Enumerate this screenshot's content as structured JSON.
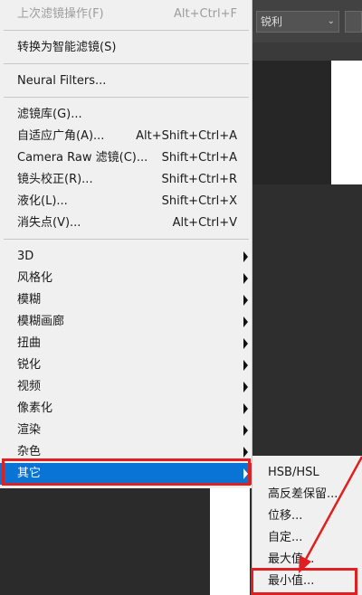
{
  "background": {
    "font_select": "锐利",
    "chevron": "⌄"
  },
  "menu": {
    "items": [
      {
        "label": "上次滤镜操作(F)",
        "shortcut": "Alt+Ctrl+F"
      },
      {
        "label": "转换为智能滤镜(S)",
        "shortcut": ""
      },
      {
        "label": "Neural Filters...",
        "shortcut": ""
      },
      {
        "label": "滤镜库(G)...",
        "shortcut": ""
      },
      {
        "label": "自适应广角(A)...",
        "shortcut": "Alt+Shift+Ctrl+A"
      },
      {
        "label": "Camera Raw 滤镜(C)...",
        "shortcut": "Shift+Ctrl+A"
      },
      {
        "label": "镜头校正(R)...",
        "shortcut": "Shift+Ctrl+R"
      },
      {
        "label": "液化(L)...",
        "shortcut": "Shift+Ctrl+X"
      },
      {
        "label": "消失点(V)...",
        "shortcut": "Alt+Ctrl+V"
      },
      {
        "label": "3D"
      },
      {
        "label": "风格化"
      },
      {
        "label": "模糊"
      },
      {
        "label": "模糊画廊"
      },
      {
        "label": "扭曲"
      },
      {
        "label": "锐化"
      },
      {
        "label": "视频"
      },
      {
        "label": "像素化"
      },
      {
        "label": "渲染"
      },
      {
        "label": "杂色"
      },
      {
        "label": "其它"
      }
    ]
  },
  "submenu": {
    "items": [
      {
        "label": "HSB/HSL"
      },
      {
        "label": "高反差保留..."
      },
      {
        "label": "位移..."
      },
      {
        "label": "自定..."
      },
      {
        "label": "最大值..."
      },
      {
        "label": "最小值..."
      }
    ]
  },
  "colors": {
    "highlight": "#0a74d6",
    "annotation": "#e02020"
  }
}
